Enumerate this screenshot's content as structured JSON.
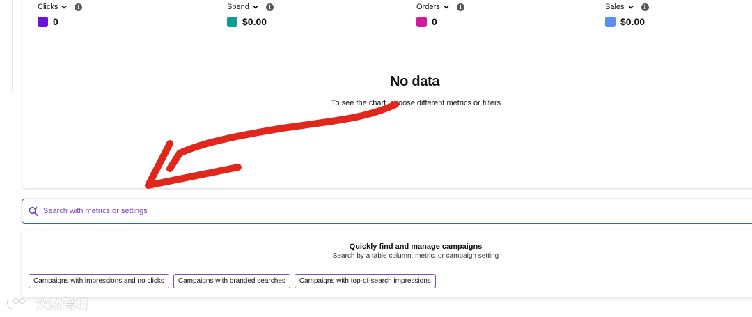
{
  "metrics": [
    {
      "label": "Clicks",
      "value": "0",
      "color": "#6a12d9"
    },
    {
      "label": "Spend",
      "value": "$0.00",
      "color": "#0e9d94"
    },
    {
      "label": "Orders",
      "value": "0",
      "color": "#d21b9c"
    },
    {
      "label": "Sales",
      "value": "$0.00",
      "color": "#5b8df2"
    }
  ],
  "empty_state": {
    "title": "No data",
    "subtitle": "To see the chart, choose different metrics or filters"
  },
  "search": {
    "placeholder": "Search with metrics or settings",
    "icon": "search-sparkle-icon"
  },
  "suggestions": {
    "title": "Quickly find and manage campaigns",
    "subtitle": "Search by a table column, metric, or campaign setting",
    "chips": [
      "Campaigns with impressions and no clicks",
      "Campaigns with branded searches",
      "Campaigns with top-of-search impressions"
    ]
  },
  "annotation": {
    "color": "#e1261c"
  },
  "watermark": {
    "text": "大数跨境"
  }
}
